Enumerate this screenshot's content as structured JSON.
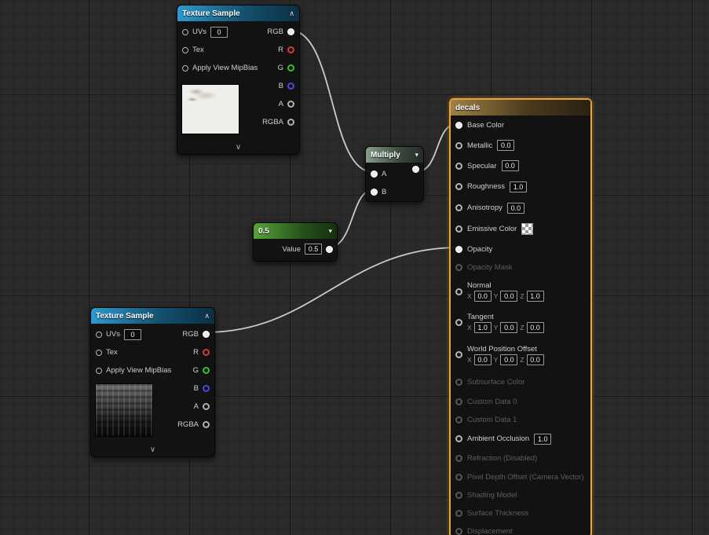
{
  "icons": {
    "collapse": "∧",
    "expand": "∨",
    "dropdown": "▾"
  },
  "colors": {
    "selection_border": "#e8a33d",
    "wire": "#d9d9d9",
    "pin_r": "#d23b3b",
    "pin_g": "#32c232",
    "pin_b": "#4a4ada",
    "header_texture_sample": "#2d9ad0",
    "header_multiply": "#86a08b",
    "header_constant": "#57a33b",
    "header_result": "#a08046",
    "background": "#2a2a2a"
  },
  "graph": {
    "axes": {
      "x": "X",
      "y": "Y",
      "z": "Z"
    },
    "texture_sample": {
      "title": "Texture Sample",
      "inputs": [
        {
          "label": "UVs",
          "value": "0"
        },
        {
          "label": "Tex"
        },
        {
          "label": "Apply View MipBias"
        }
      ],
      "outputs": [
        {
          "label": "RGB",
          "connected": true
        },
        {
          "label": "R"
        },
        {
          "label": "G"
        },
        {
          "label": "B"
        },
        {
          "label": "A"
        },
        {
          "label": "RGBA"
        }
      ]
    },
    "multiply": {
      "title": "Multiply",
      "inputs": [
        {
          "label": "A",
          "connected": true
        },
        {
          "label": "B",
          "connected": true
        }
      ]
    },
    "constant": {
      "title": "0.5",
      "value_label": "Value",
      "value": "0.5"
    },
    "decals": {
      "title": "decals",
      "inputs": [
        {
          "label": "Base Color",
          "connected": true
        },
        {
          "label": "Metallic",
          "value": "0.0"
        },
        {
          "label": "Specular",
          "value": "0.0"
        },
        {
          "label": "Roughness",
          "value": "1.0"
        },
        {
          "label": "Anisotropy",
          "value": "0.0"
        },
        {
          "label": "Emissive Color",
          "swatch": "checker"
        },
        {
          "label": "Opacity",
          "connected": true
        },
        {
          "label": "Opacity Mask",
          "disabled": true
        },
        {
          "label": "Normal",
          "x": "0.0",
          "y": "0.0",
          "z": "1.0"
        },
        {
          "label": "Tangent",
          "x": "1.0",
          "y": "0.0",
          "z": "0.0"
        },
        {
          "label": "World Position Offset",
          "x": "0.0",
          "y": "0.0",
          "z": "0.0"
        },
        {
          "label": "Subsurface Color",
          "disabled": true
        },
        {
          "label": "Custom Data 0",
          "disabled": true
        },
        {
          "label": "Custom Data 1",
          "disabled": true
        },
        {
          "label": "Ambient Occlusion",
          "value": "1.0"
        },
        {
          "label": "Refraction (Disabled)",
          "disabled": true
        },
        {
          "label": "Pixel Depth Offset (Camera Vector)",
          "disabled": true
        },
        {
          "label": "Shading Model",
          "disabled": true
        },
        {
          "label": "Surface Thickness",
          "disabled": true
        },
        {
          "label": "Displacement",
          "disabled": true
        }
      ]
    },
    "connections": [
      {
        "from": "texture-sample-top.RGB",
        "to": "multiply.A"
      },
      {
        "from": "constant-0.5.Value",
        "to": "multiply.B"
      },
      {
        "from": "multiply.out",
        "to": "decals.Base Color"
      },
      {
        "from": "texture-sample-bottom.RGB",
        "to": "decals.Opacity"
      }
    ]
  }
}
